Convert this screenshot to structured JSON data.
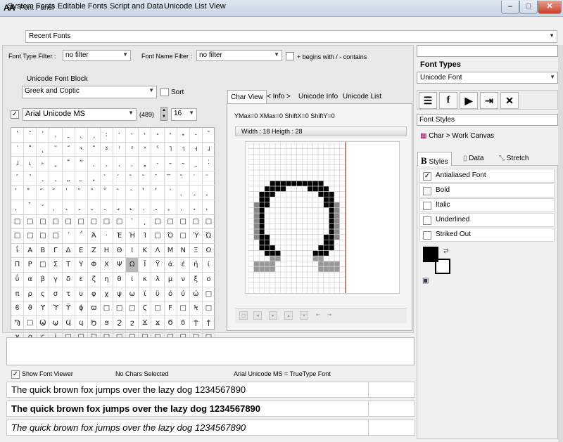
{
  "window": {
    "title": "Font Panel",
    "app_icon": "AA",
    "minimize": "–",
    "maximize": "□",
    "close": "✕"
  },
  "menu": [
    "System Fonts",
    "Editable Fonts",
    "Script and Data",
    "Unicode List",
    "View"
  ],
  "recent_fonts": "Recent Fonts",
  "filters": {
    "type_label": "Font Type Filter :",
    "type_value": "no filter",
    "name_label": "Font Name Filter :",
    "name_value": "no filter",
    "begins_label": "+ begins with / - contains"
  },
  "unicode_block": {
    "label": "Unicode Font Block",
    "value": "Greek and Coptic",
    "sort_label": "Sort"
  },
  "font_select": {
    "checked": "✓",
    "name": "Arial Unicode MS",
    "count": "(489)",
    "size": "16"
  },
  "glyphs": [
    "ʹ",
    "ˆ",
    "ˈ",
    "ˌ",
    "ˍ",
    "ˎ",
    "ˏ",
    "ː",
    "ˑ",
    "˒",
    "˓",
    "˔",
    "˕",
    "˖",
    "˗",
    "˘",
    "˙",
    "˚",
    "˛",
    "˜",
    "˝",
    "˞",
    "˟",
    "ˠ",
    "ˡ",
    "ˢ",
    "ˣ",
    "ˤ",
    "˥",
    "˦",
    "˧",
    "˨",
    "˩",
    "˪",
    "˫",
    "ˬ",
    "˭",
    "ˮ",
    "˯",
    "˰",
    "˱",
    "˲",
    "˳",
    "˴",
    "˵",
    "˶",
    "˷",
    "˸",
    "˹",
    "˺",
    "˻",
    "˼",
    "˽",
    "˾",
    "˿",
    "̀",
    "́",
    "̂",
    "̃",
    "̄",
    "̅",
    "̆",
    "̇",
    "̈",
    "̉",
    "̊",
    "̋",
    "̌",
    "̍",
    "̎",
    "̏",
    "̐",
    "̑",
    "̒",
    "̓",
    "̔",
    "̕",
    "̖",
    "̗",
    "̘",
    "̙",
    "̚",
    "̛",
    "̜",
    "̝",
    "̞",
    "̟",
    "̠",
    "̡",
    "̢",
    "̣",
    "̤",
    "̥",
    "̦",
    "̧",
    "̨",
    "□",
    "□",
    "□",
    "□",
    "□",
    "□",
    "□",
    "□",
    "□",
    "ʹ",
    "͵",
    "□",
    "□",
    "□",
    "□",
    "□",
    "□",
    "□",
    "□",
    "□",
    "΄",
    "΅",
    "Ά",
    "·",
    "Έ",
    "Ή",
    "Ί",
    "□",
    "Ό",
    "□",
    "Ύ",
    "Ώ",
    "ΐ",
    "Α",
    "Β",
    "Γ",
    "Δ",
    "Ε",
    "Ζ",
    "Η",
    "Θ",
    "Ι",
    "Κ",
    "Λ",
    "Μ",
    "Ν",
    "Ξ",
    "Ο",
    "Π",
    "Ρ",
    "□",
    "Σ",
    "Τ",
    "Υ",
    "Φ",
    "Χ",
    "Ψ",
    "Ω",
    "Ϊ",
    "Ϋ",
    "ά",
    "έ",
    "ή",
    "ί",
    "ΰ",
    "α",
    "β",
    "γ",
    "δ",
    "ε",
    "ζ",
    "η",
    "θ",
    "ι",
    "κ",
    "λ",
    "μ",
    "ν",
    "ξ",
    "ο",
    "π",
    "ρ",
    "ς",
    "σ",
    "τ",
    "υ",
    "φ",
    "χ",
    "ψ",
    "ω",
    "ϊ",
    "ϋ",
    "ό",
    "ύ",
    "ώ",
    "□",
    "ϐ",
    "ϑ",
    "ϒ",
    "ϓ",
    "ϔ",
    "ϕ",
    "ϖ",
    "□",
    "□",
    "□",
    "Ϛ",
    "□",
    "Ϝ",
    "□",
    "Ϟ",
    "□",
    "Ϡ",
    "□",
    "Ϣ",
    "ϣ",
    "Ϥ",
    "ϥ",
    "Ϧ",
    "ϧ",
    "Ϩ",
    "ϩ",
    "Ϫ",
    "ϫ",
    "Ϭ",
    "ϭ",
    "Ϯ",
    "ϯ",
    "ϰ",
    "ϱ",
    "ϲ",
    "ϳ",
    "□",
    "□",
    "□",
    "□",
    "□",
    "□",
    "□",
    "□",
    "□",
    "□",
    "□",
    "□"
  ],
  "char_view": {
    "tabs": [
      "Char View",
      "< Info >",
      "Unicode Info",
      "Unicode List"
    ],
    "metrics": "YMax=0  XMax=0  ShiftX=0  ShiftY=0",
    "size": "Width : 18  Heigth : 28",
    "grid_cols": 18,
    "grid_rows": 28,
    "bitmap": [
      "..................",
      "..................",
      "..................",
      "..................",
      "..................",
      "..................",
      "..................",
      "....##########....",
      "...####....####...",
      "..###........###..",
      "..##..........##..",
      ".###..........###.",
      ".##............##.",
      ".##............##.",
      ".##............##.",
      ".##............##.",
      ".##............##.",
      ".###..........###.",
      "..##..........##..",
      "..###........###..",
      "...###......###...",
      "....##......##....",
      ".####........####.",
      ".####........####.",
      "..................",
      "..................",
      "..................",
      ".................."
    ]
  },
  "status": {
    "show_viewer": "Show Font Viewer",
    "no_chars": "No Chars Selected",
    "font_type": "Arial Unicode MS = TrueType Font"
  },
  "samples": [
    "The quick brown fox jumps over the lazy dog 1234567890",
    "The quick brown fox jumps over the lazy dog 1234567890",
    "The quick brown fox jumps over the lazy dog 1234567890"
  ],
  "right": {
    "font_types_label": "Font Types",
    "font_type_value": "Unicode Font",
    "font_styles": "Font Styles",
    "char_work": "Char > Work Canvas",
    "tabs": [
      "Styles",
      "Data",
      "Stretch"
    ],
    "styles": [
      {
        "label": "Antialiased Font",
        "checked": true
      },
      {
        "label": "Bold",
        "checked": false
      },
      {
        "label": "Italic",
        "checked": false
      },
      {
        "label": "Underlined",
        "checked": false
      },
      {
        "label": "Striked Out",
        "checked": false
      }
    ]
  },
  "colors": {
    "foreground": "#000000",
    "background": "#ffffff",
    "guide_line": "#cc0000"
  }
}
